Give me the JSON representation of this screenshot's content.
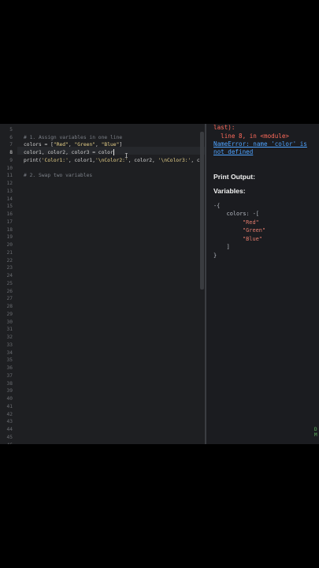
{
  "editor": {
    "line_numbers": [
      "5",
      "6",
      "7",
      "8",
      "9",
      "10",
      "11",
      "12",
      "13",
      "14",
      "15",
      "16",
      "17",
      "18",
      "19",
      "20",
      "21",
      "22",
      "23",
      "24",
      "25",
      "26",
      "27",
      "28",
      "29",
      "30",
      "31",
      "32",
      "33",
      "34",
      "35",
      "36",
      "37",
      "38",
      "39",
      "40",
      "41",
      "42",
      "43",
      "44",
      "45",
      "46"
    ],
    "active_line": "8",
    "line6": "# 1. Assign variables in one line",
    "line7_a": "colors = [",
    "line7_s1": "\"Red\"",
    "line7_s2": "\"Green\"",
    "line7_s3": "\"Blue\"",
    "line7_b": "]",
    "line8": "color1, color2, color3 = color",
    "line9_a": "print(",
    "line9_s1": "'Color1:'",
    "line9_b": ", color1,",
    "line9_s2": "'\\nColor2:'",
    "line9_c": ", color2, ",
    "line9_s3": "'\\nColor3:'",
    "line9_d": ", c",
    "line10": "# 2. Swap two variables"
  },
  "output": {
    "err_line1": "last):",
    "err_line2": "  line 8, in <module>",
    "err_link1": "NameError: name 'color' is",
    "err_link2": "not defined",
    "print_heading": "Print Output:",
    "vars_heading": "Variables:",
    "vars_open": "-{",
    "vars_key": "    colors: -[",
    "vars_v1": "\"Red\"",
    "vars_v2": "\"Green\"",
    "vars_v3": "\"Blue\"",
    "vars_close_list": "    ]",
    "vars_close": "}",
    "green_1": "D",
    "green_2": "M"
  },
  "colors": {
    "background": "#1e1f22",
    "comment": "#7c8088",
    "string": "#e8d28a",
    "error": "#ff6b5b",
    "link": "#4ea3ff"
  }
}
